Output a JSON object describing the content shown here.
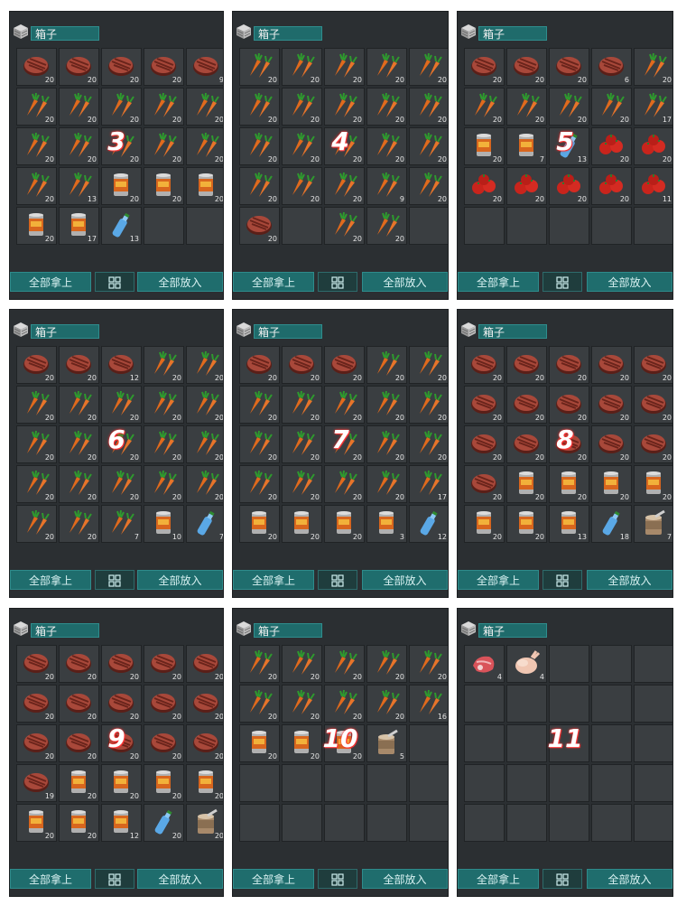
{
  "screens": [
    {
      "step": "3",
      "title": "箱子",
      "take_all": "全部拿上",
      "put_all": "全部放入",
      "slots": [
        {
          "item": "steak",
          "qty": "20"
        },
        {
          "item": "steak",
          "qty": "20"
        },
        {
          "item": "steak",
          "qty": "20"
        },
        {
          "item": "steak",
          "qty": "20"
        },
        {
          "item": "steak",
          "qty": "9"
        },
        {
          "item": "carrot",
          "qty": "20"
        },
        {
          "item": "carrot",
          "qty": "20"
        },
        {
          "item": "carrot",
          "qty": "20"
        },
        {
          "item": "carrot",
          "qty": "20"
        },
        {
          "item": "carrot",
          "qty": "20"
        },
        {
          "item": "carrot",
          "qty": "20"
        },
        {
          "item": "carrot",
          "qty": "20"
        },
        {
          "item": "carrot",
          "qty": "20"
        },
        {
          "item": "carrot",
          "qty": "20"
        },
        {
          "item": "carrot",
          "qty": "20"
        },
        {
          "item": "carrot",
          "qty": "20"
        },
        {
          "item": "carrot",
          "qty": "13"
        },
        {
          "item": "can",
          "qty": "20"
        },
        {
          "item": "can",
          "qty": "20"
        },
        {
          "item": "can",
          "qty": "20"
        },
        {
          "item": "can",
          "qty": "20"
        },
        {
          "item": "can",
          "qty": "17"
        },
        {
          "item": "bottle",
          "qty": "13"
        },
        {
          "item": "empty",
          "qty": ""
        },
        {
          "item": "empty",
          "qty": ""
        }
      ]
    },
    {
      "step": "4",
      "title": "箱子",
      "take_all": "全部拿上",
      "put_all": "全部放入",
      "slots": [
        {
          "item": "carrot",
          "qty": "20"
        },
        {
          "item": "carrot",
          "qty": "20"
        },
        {
          "item": "carrot",
          "qty": "20"
        },
        {
          "item": "carrot",
          "qty": "20"
        },
        {
          "item": "carrot",
          "qty": "20"
        },
        {
          "item": "carrot",
          "qty": "20"
        },
        {
          "item": "carrot",
          "qty": "20"
        },
        {
          "item": "carrot",
          "qty": "20"
        },
        {
          "item": "carrot",
          "qty": "20"
        },
        {
          "item": "carrot",
          "qty": "20"
        },
        {
          "item": "carrot",
          "qty": "20"
        },
        {
          "item": "carrot",
          "qty": "20"
        },
        {
          "item": "carrot",
          "qty": "20"
        },
        {
          "item": "carrot",
          "qty": "20"
        },
        {
          "item": "carrot",
          "qty": "20"
        },
        {
          "item": "carrot",
          "qty": "20"
        },
        {
          "item": "carrot",
          "qty": "20"
        },
        {
          "item": "carrot",
          "qty": "20"
        },
        {
          "item": "carrot",
          "qty": "9"
        },
        {
          "item": "carrot",
          "qty": "20"
        },
        {
          "item": "steak",
          "qty": "20"
        },
        {
          "item": "empty",
          "qty": ""
        },
        {
          "item": "carrot",
          "qty": "20"
        },
        {
          "item": "carrot",
          "qty": "20"
        },
        {
          "item": "empty",
          "qty": ""
        }
      ]
    },
    {
      "step": "5",
      "title": "箱子",
      "take_all": "全部拿上",
      "put_all": "全部放入",
      "slots": [
        {
          "item": "steak",
          "qty": "20"
        },
        {
          "item": "steak",
          "qty": "20"
        },
        {
          "item": "steak",
          "qty": "20"
        },
        {
          "item": "steak",
          "qty": "6"
        },
        {
          "item": "carrot",
          "qty": "20"
        },
        {
          "item": "carrot",
          "qty": "20"
        },
        {
          "item": "carrot",
          "qty": "20"
        },
        {
          "item": "carrot",
          "qty": "20"
        },
        {
          "item": "carrot",
          "qty": "20"
        },
        {
          "item": "carrot",
          "qty": "17"
        },
        {
          "item": "can",
          "qty": "20"
        },
        {
          "item": "can",
          "qty": "7"
        },
        {
          "item": "bottle",
          "qty": "13"
        },
        {
          "item": "tomato",
          "qty": "20"
        },
        {
          "item": "tomato",
          "qty": "20"
        },
        {
          "item": "tomato",
          "qty": "20"
        },
        {
          "item": "tomato",
          "qty": "20"
        },
        {
          "item": "tomato",
          "qty": "20"
        },
        {
          "item": "tomato",
          "qty": "20"
        },
        {
          "item": "tomato",
          "qty": "11"
        },
        {
          "item": "empty",
          "qty": ""
        },
        {
          "item": "empty",
          "qty": ""
        },
        {
          "item": "empty",
          "qty": ""
        },
        {
          "item": "empty",
          "qty": ""
        },
        {
          "item": "empty",
          "qty": ""
        }
      ]
    },
    {
      "step": "6",
      "title": "箱子",
      "take_all": "全部拿上",
      "put_all": "全部放入",
      "slots": [
        {
          "item": "steak",
          "qty": "20"
        },
        {
          "item": "steak",
          "qty": "20"
        },
        {
          "item": "steak",
          "qty": "12"
        },
        {
          "item": "carrot",
          "qty": "20"
        },
        {
          "item": "carrot",
          "qty": "20"
        },
        {
          "item": "carrot",
          "qty": "20"
        },
        {
          "item": "carrot",
          "qty": "20"
        },
        {
          "item": "carrot",
          "qty": "20"
        },
        {
          "item": "carrot",
          "qty": "20"
        },
        {
          "item": "carrot",
          "qty": "20"
        },
        {
          "item": "carrot",
          "qty": "20"
        },
        {
          "item": "carrot",
          "qty": "20"
        },
        {
          "item": "carrot",
          "qty": "20"
        },
        {
          "item": "carrot",
          "qty": "20"
        },
        {
          "item": "carrot",
          "qty": "20"
        },
        {
          "item": "carrot",
          "qty": "20"
        },
        {
          "item": "carrot",
          "qty": "20"
        },
        {
          "item": "carrot",
          "qty": "20"
        },
        {
          "item": "carrot",
          "qty": "20"
        },
        {
          "item": "carrot",
          "qty": "20"
        },
        {
          "item": "carrot",
          "qty": "20"
        },
        {
          "item": "carrot",
          "qty": "20"
        },
        {
          "item": "carrot",
          "qty": "7"
        },
        {
          "item": "can",
          "qty": "10"
        },
        {
          "item": "bottle",
          "qty": "7"
        }
      ]
    },
    {
      "step": "7",
      "title": "箱子",
      "take_all": "全部拿上",
      "put_all": "全部放入",
      "slots": [
        {
          "item": "steak",
          "qty": "20"
        },
        {
          "item": "steak",
          "qty": "20"
        },
        {
          "item": "steak",
          "qty": "20"
        },
        {
          "item": "carrot",
          "qty": "20"
        },
        {
          "item": "carrot",
          "qty": "20"
        },
        {
          "item": "carrot",
          "qty": "20"
        },
        {
          "item": "carrot",
          "qty": "20"
        },
        {
          "item": "carrot",
          "qty": "20"
        },
        {
          "item": "carrot",
          "qty": "20"
        },
        {
          "item": "carrot",
          "qty": "20"
        },
        {
          "item": "carrot",
          "qty": "20"
        },
        {
          "item": "carrot",
          "qty": "20"
        },
        {
          "item": "carrot",
          "qty": "20"
        },
        {
          "item": "carrot",
          "qty": "20"
        },
        {
          "item": "carrot",
          "qty": "20"
        },
        {
          "item": "carrot",
          "qty": "20"
        },
        {
          "item": "carrot",
          "qty": "20"
        },
        {
          "item": "carrot",
          "qty": "20"
        },
        {
          "item": "carrot",
          "qty": "20"
        },
        {
          "item": "carrot",
          "qty": "17"
        },
        {
          "item": "can",
          "qty": "20"
        },
        {
          "item": "can",
          "qty": "20"
        },
        {
          "item": "can",
          "qty": "20"
        },
        {
          "item": "can",
          "qty": "3"
        },
        {
          "item": "bottle",
          "qty": "12"
        }
      ]
    },
    {
      "step": "8",
      "title": "箱子",
      "take_all": "全部拿上",
      "put_all": "全部放入",
      "slots": [
        {
          "item": "steak",
          "qty": "20"
        },
        {
          "item": "steak",
          "qty": "20"
        },
        {
          "item": "steak",
          "qty": "20"
        },
        {
          "item": "steak",
          "qty": "20"
        },
        {
          "item": "steak",
          "qty": "20"
        },
        {
          "item": "steak",
          "qty": "20"
        },
        {
          "item": "steak",
          "qty": "20"
        },
        {
          "item": "steak",
          "qty": "20"
        },
        {
          "item": "steak",
          "qty": "20"
        },
        {
          "item": "steak",
          "qty": "20"
        },
        {
          "item": "steak",
          "qty": "20"
        },
        {
          "item": "steak",
          "qty": "20"
        },
        {
          "item": "steak",
          "qty": "20"
        },
        {
          "item": "steak",
          "qty": "20"
        },
        {
          "item": "steak",
          "qty": "20"
        },
        {
          "item": "steak",
          "qty": "20"
        },
        {
          "item": "can",
          "qty": "20"
        },
        {
          "item": "can",
          "qty": "20"
        },
        {
          "item": "can",
          "qty": "20"
        },
        {
          "item": "can",
          "qty": "20"
        },
        {
          "item": "can",
          "qty": "20"
        },
        {
          "item": "can",
          "qty": "20"
        },
        {
          "item": "can",
          "qty": "13"
        },
        {
          "item": "bottle",
          "qty": "18"
        },
        {
          "item": "opencan",
          "qty": "7"
        }
      ]
    },
    {
      "step": "9",
      "title": "箱子",
      "take_all": "全部拿上",
      "put_all": "全部放入",
      "slots": [
        {
          "item": "steak",
          "qty": "20"
        },
        {
          "item": "steak",
          "qty": "20"
        },
        {
          "item": "steak",
          "qty": "20"
        },
        {
          "item": "steak",
          "qty": "20"
        },
        {
          "item": "steak",
          "qty": "20"
        },
        {
          "item": "steak",
          "qty": "20"
        },
        {
          "item": "steak",
          "qty": "20"
        },
        {
          "item": "steak",
          "qty": "20"
        },
        {
          "item": "steak",
          "qty": "20"
        },
        {
          "item": "steak",
          "qty": "20"
        },
        {
          "item": "steak",
          "qty": "20"
        },
        {
          "item": "steak",
          "qty": "20"
        },
        {
          "item": "steak",
          "qty": "20"
        },
        {
          "item": "steak",
          "qty": "20"
        },
        {
          "item": "steak",
          "qty": "20"
        },
        {
          "item": "steak",
          "qty": "19"
        },
        {
          "item": "can",
          "qty": "20"
        },
        {
          "item": "can",
          "qty": "20"
        },
        {
          "item": "can",
          "qty": "20"
        },
        {
          "item": "can",
          "qty": "20"
        },
        {
          "item": "can",
          "qty": "20"
        },
        {
          "item": "can",
          "qty": "20"
        },
        {
          "item": "can",
          "qty": "12"
        },
        {
          "item": "bottle",
          "qty": "20"
        },
        {
          "item": "opencan",
          "qty": "20"
        }
      ]
    },
    {
      "step": "10",
      "title": "箱子",
      "take_all": "全部拿上",
      "put_all": "全部放入",
      "slots": [
        {
          "item": "carrot",
          "qty": "20"
        },
        {
          "item": "carrot",
          "qty": "20"
        },
        {
          "item": "carrot",
          "qty": "20"
        },
        {
          "item": "carrot",
          "qty": "20"
        },
        {
          "item": "carrot",
          "qty": "20"
        },
        {
          "item": "carrot",
          "qty": "20"
        },
        {
          "item": "carrot",
          "qty": "20"
        },
        {
          "item": "carrot",
          "qty": "20"
        },
        {
          "item": "carrot",
          "qty": "20"
        },
        {
          "item": "carrot",
          "qty": "16"
        },
        {
          "item": "can",
          "qty": "20"
        },
        {
          "item": "can",
          "qty": "20"
        },
        {
          "item": "can",
          "qty": "20"
        },
        {
          "item": "opencan",
          "qty": "5"
        },
        {
          "item": "empty",
          "qty": ""
        },
        {
          "item": "empty",
          "qty": ""
        },
        {
          "item": "empty",
          "qty": ""
        },
        {
          "item": "empty",
          "qty": ""
        },
        {
          "item": "empty",
          "qty": ""
        },
        {
          "item": "empty",
          "qty": ""
        },
        {
          "item": "empty",
          "qty": ""
        },
        {
          "item": "empty",
          "qty": ""
        },
        {
          "item": "empty",
          "qty": ""
        },
        {
          "item": "empty",
          "qty": ""
        },
        {
          "item": "empty",
          "qty": ""
        }
      ]
    },
    {
      "step": "11",
      "title": "箱子",
      "take_all": "全部拿上",
      "put_all": "全部放入",
      "slots": [
        {
          "item": "rawmeat",
          "qty": "4"
        },
        {
          "item": "chicken",
          "qty": "4"
        },
        {
          "item": "empty",
          "qty": ""
        },
        {
          "item": "empty",
          "qty": ""
        },
        {
          "item": "empty",
          "qty": ""
        },
        {
          "item": "empty",
          "qty": ""
        },
        {
          "item": "empty",
          "qty": ""
        },
        {
          "item": "empty",
          "qty": ""
        },
        {
          "item": "empty",
          "qty": ""
        },
        {
          "item": "empty",
          "qty": ""
        },
        {
          "item": "empty",
          "qty": ""
        },
        {
          "item": "empty",
          "qty": ""
        },
        {
          "item": "empty",
          "qty": ""
        },
        {
          "item": "empty",
          "qty": ""
        },
        {
          "item": "empty",
          "qty": ""
        },
        {
          "item": "empty",
          "qty": ""
        },
        {
          "item": "empty",
          "qty": ""
        },
        {
          "item": "empty",
          "qty": ""
        },
        {
          "item": "empty",
          "qty": ""
        },
        {
          "item": "empty",
          "qty": ""
        },
        {
          "item": "empty",
          "qty": ""
        },
        {
          "item": "empty",
          "qty": ""
        },
        {
          "item": "empty",
          "qty": ""
        },
        {
          "item": "empty",
          "qty": ""
        },
        {
          "item": "empty",
          "qty": ""
        }
      ]
    }
  ]
}
